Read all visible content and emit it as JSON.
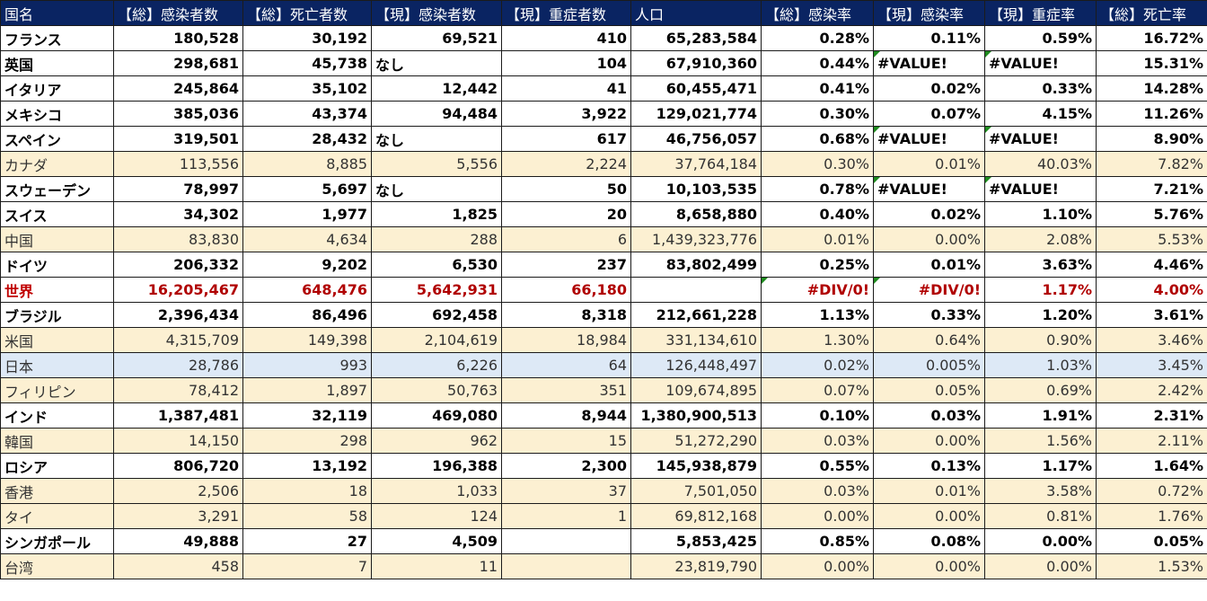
{
  "headers": [
    "国名",
    "【総】感染者数",
    "【総】死亡者数",
    "【現】感染者数",
    "【現】重症者数",
    "人口",
    "【総】感染率",
    "【現】感染率",
    "【現】重症率",
    "【総】死亡率"
  ],
  "rows": [
    {
      "style": "bold",
      "cells": [
        "フランス",
        "180,528",
        "30,192",
        "69,521",
        "410",
        "65,283,584",
        "0.28%",
        "0.11%",
        "0.59%",
        "16.72%"
      ]
    },
    {
      "style": "bold",
      "cells": [
        "英国",
        "298,681",
        "45,738",
        "なし",
        "104",
        "67,910,360",
        "0.44%",
        "#VALUE!",
        "#VALUE!",
        "15.31%"
      ]
    },
    {
      "style": "bold",
      "cells": [
        "イタリア",
        "245,864",
        "35,102",
        "12,442",
        "41",
        "60,455,471",
        "0.41%",
        "0.02%",
        "0.33%",
        "14.28%"
      ]
    },
    {
      "style": "bold",
      "cells": [
        "メキシコ",
        "385,036",
        "43,374",
        "94,484",
        "3,922",
        "129,021,774",
        "0.30%",
        "0.07%",
        "4.15%",
        "11.26%"
      ]
    },
    {
      "style": "bold",
      "cells": [
        "スペイン",
        "319,501",
        "28,432",
        "なし",
        "617",
        "46,756,057",
        "0.68%",
        "#VALUE!",
        "#VALUE!",
        "8.90%"
      ]
    },
    {
      "style": "cream",
      "cells": [
        "カナダ",
        "113,556",
        "8,885",
        "5,556",
        "2,224",
        "37,764,184",
        "0.30%",
        "0.01%",
        "40.03%",
        "7.82%"
      ]
    },
    {
      "style": "bold",
      "cells": [
        "スウェーデン",
        "78,997",
        "5,697",
        "なし",
        "50",
        "10,103,535",
        "0.78%",
        "#VALUE!",
        "#VALUE!",
        "7.21%"
      ]
    },
    {
      "style": "bold",
      "cells": [
        "スイス",
        "34,302",
        "1,977",
        "1,825",
        "20",
        "8,658,880",
        "0.40%",
        "0.02%",
        "1.10%",
        "5.76%"
      ]
    },
    {
      "style": "cream",
      "cells": [
        "中国",
        "83,830",
        "4,634",
        "288",
        "6",
        "1,439,323,776",
        "0.01%",
        "0.00%",
        "2.08%",
        "5.53%"
      ]
    },
    {
      "style": "bold",
      "cells": [
        "ドイツ",
        "206,332",
        "9,202",
        "6,530",
        "237",
        "83,802,499",
        "0.25%",
        "0.01%",
        "3.63%",
        "4.46%"
      ]
    },
    {
      "style": "world",
      "cells": [
        "世界",
        "16,205,467",
        "648,476",
        "5,642,931",
        "66,180",
        "",
        "#DIV/0!",
        "#DIV/0!",
        "1.17%",
        "4.00%"
      ]
    },
    {
      "style": "bold",
      "cells": [
        "ブラジル",
        "2,396,434",
        "86,496",
        "692,458",
        "8,318",
        "212,661,228",
        "1.13%",
        "0.33%",
        "1.20%",
        "3.61%"
      ]
    },
    {
      "style": "cream",
      "cells": [
        "米国",
        "4,315,709",
        "149,398",
        "2,104,619",
        "18,984",
        "331,134,610",
        "1.30%",
        "0.64%",
        "0.90%",
        "3.46%"
      ]
    },
    {
      "style": "blue",
      "cells": [
        "日本",
        "28,786",
        "993",
        "6,226",
        "64",
        "126,448,497",
        "0.02%",
        "0.005%",
        "1.03%",
        "3.45%"
      ]
    },
    {
      "style": "cream",
      "cells": [
        "フィリピン",
        "78,412",
        "1,897",
        "50,763",
        "351",
        "109,674,895",
        "0.07%",
        "0.05%",
        "0.69%",
        "2.42%"
      ]
    },
    {
      "style": "bold",
      "cells": [
        "インド",
        "1,387,481",
        "32,119",
        "469,080",
        "8,944",
        "1,380,900,513",
        "0.10%",
        "0.03%",
        "1.91%",
        "2.31%"
      ]
    },
    {
      "style": "cream",
      "cells": [
        "韓国",
        "14,150",
        "298",
        "962",
        "15",
        "51,272,290",
        "0.03%",
        "0.00%",
        "1.56%",
        "2.11%"
      ]
    },
    {
      "style": "bold",
      "cells": [
        "ロシア",
        "806,720",
        "13,192",
        "196,388",
        "2,300",
        "145,938,879",
        "0.55%",
        "0.13%",
        "1.17%",
        "1.64%"
      ]
    },
    {
      "style": "cream",
      "cells": [
        "香港",
        "2,506",
        "18",
        "1,033",
        "37",
        "7,501,050",
        "0.03%",
        "0.01%",
        "3.58%",
        "0.72%"
      ]
    },
    {
      "style": "cream",
      "cells": [
        "タイ",
        "3,291",
        "58",
        "124",
        "1",
        "69,812,168",
        "0.00%",
        "0.00%",
        "0.81%",
        "1.76%"
      ]
    },
    {
      "style": "bold",
      "cells": [
        "シンガポール",
        "49,888",
        "27",
        "4,509",
        "",
        "5,853,425",
        "0.85%",
        "0.08%",
        "0.00%",
        "0.05%"
      ]
    },
    {
      "style": "cream",
      "cells": [
        "台湾",
        "458",
        "7",
        "11",
        "",
        "23,819,790",
        "0.00%",
        "0.00%",
        "0.00%",
        "1.53%"
      ]
    }
  ],
  "colors": {
    "header_bg": "#0a2462",
    "header_text": "#ffffff",
    "cream_row": "#fcf0d2",
    "japan_row": "#dde9f6",
    "world_text": "#b00000",
    "error_flag": "#1e8a1e"
  }
}
